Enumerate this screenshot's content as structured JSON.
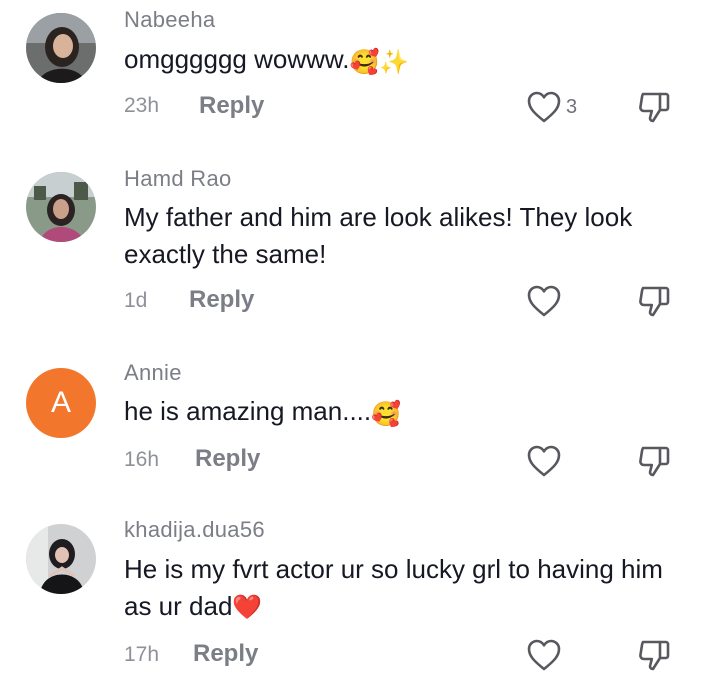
{
  "comments": [
    {
      "username": "Nabeeha",
      "text": "omgggggg wowww.",
      "emoji": "🥰✨",
      "time": "23h",
      "reply_label": "Reply",
      "like_count": "3",
      "avatar_icon": "profile-photo-icon"
    },
    {
      "username": "Hamd Rao",
      "text": "My father and him are look alikes! They look exactly the same!",
      "emoji": "",
      "time": "1d",
      "reply_label": "Reply",
      "like_count": "",
      "avatar_icon": "profile-photo-icon"
    },
    {
      "username": "Annie",
      "avatar_letter": "A",
      "avatar_color": "#f2772d",
      "text": "he is amazing man....",
      "emoji": "🥰",
      "time": "16h",
      "reply_label": "Reply",
      "like_count": "",
      "avatar_icon": "letter-avatar"
    },
    {
      "username": "khadija.dua56",
      "text": "He is my fvrt actor ur so lucky grl to having him as ur dad",
      "emoji": "❤️",
      "time": "17h",
      "reply_label": "Reply",
      "like_count": "",
      "avatar_icon": "profile-photo-icon"
    }
  ]
}
